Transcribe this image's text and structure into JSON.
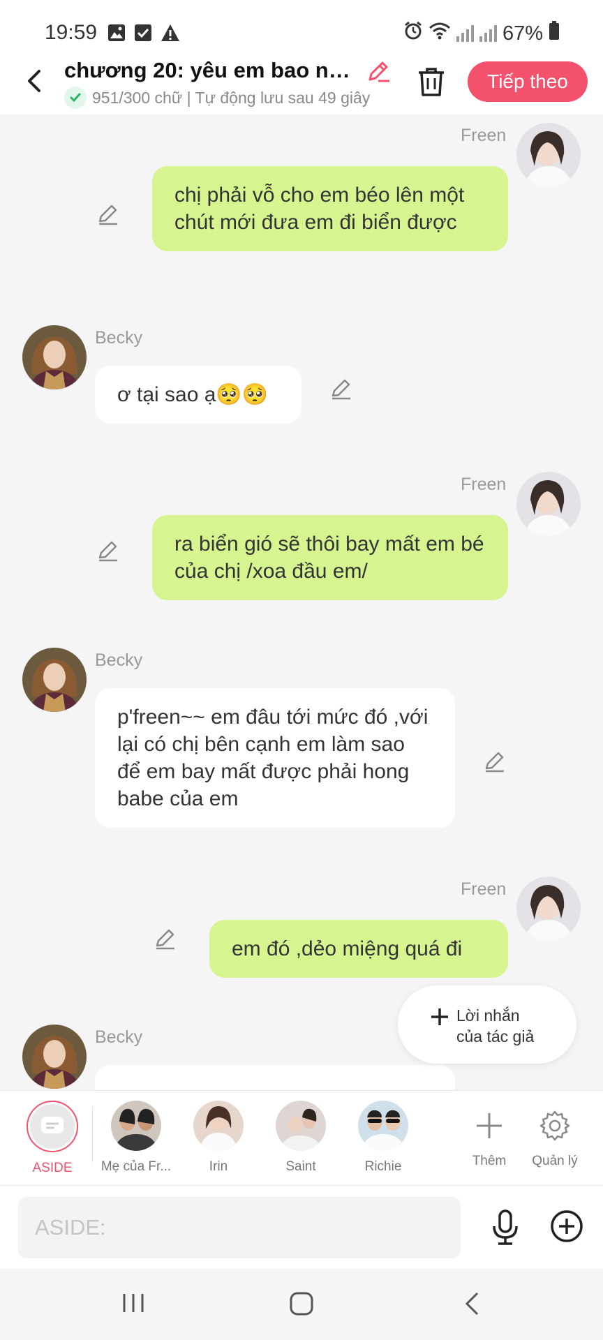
{
  "status_bar": {
    "time": "19:59",
    "battery": "67%"
  },
  "header": {
    "title": "chương 20: yêu em bao nh...",
    "status_line": "951/300 chữ | Tự động lưu sau 49 giây",
    "next_button": "Tiếp theo"
  },
  "messages": [
    {
      "side": "right",
      "name": "Freen",
      "text": "chị phải vỗ cho em béo lên một chút mới đưa em đi biển được"
    },
    {
      "side": "left",
      "name": "Becky",
      "text": "ơ tại sao ạ🥺🥺"
    },
    {
      "side": "right",
      "name": "Freen",
      "text": "ra biển gió sẽ thôi bay mất em bé của chị /xoa đầu em/"
    },
    {
      "side": "left",
      "name": "Becky",
      "text": "p'freen~~ em đâu tới mức đó ,với lại có chị bên cạnh em làm sao để em bay mất được phải hong babe của em"
    },
    {
      "side": "right",
      "name": "Freen",
      "text": "em đó ,dẻo miệng quá đi"
    },
    {
      "side": "left",
      "name": "Becky",
      "text": ""
    }
  ],
  "author_note_button": {
    "line1": "Lời nhắn",
    "line2": "của tác giả"
  },
  "character_bar": {
    "items": [
      {
        "label": "ASIDE",
        "active": true
      },
      {
        "label": "Mẹ của Fr..."
      },
      {
        "label": "Irin"
      },
      {
        "label": "Saint"
      },
      {
        "label": "Richie"
      }
    ],
    "add_label": "Thêm",
    "manage_label": "Quản lý"
  },
  "input": {
    "placeholder": "ASIDE:"
  },
  "colors": {
    "accent": "#f4516c",
    "bubble_right": "#d6f590",
    "bubble_left": "#ffffff",
    "background": "#f5f5f5"
  }
}
